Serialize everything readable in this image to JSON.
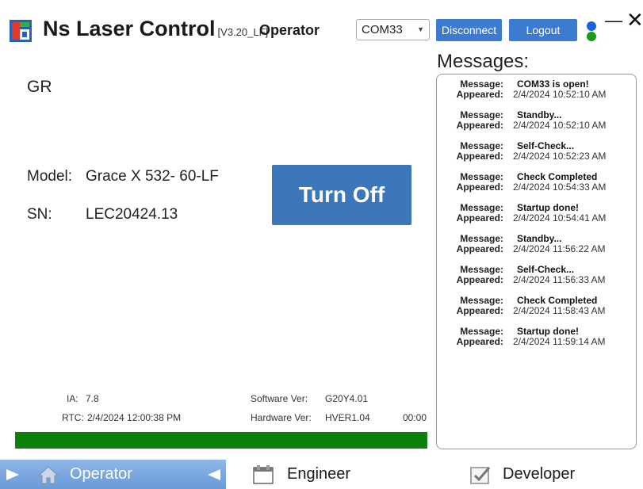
{
  "app": {
    "title": "Ns Laser Control",
    "version": "[V3.20_LF]",
    "mode": "Operator"
  },
  "toolbar": {
    "com_port": "COM33",
    "disconnect_label": "Disconnect",
    "logout_label": "Logout",
    "status_dot_colors": [
      "#1565e0",
      "#1a9a1a"
    ]
  },
  "main": {
    "gr_label": "GR",
    "model_label": "Model:",
    "model_value": "Grace X 532- 60-LF",
    "sn_label": "SN:",
    "sn_value": "LEC20424.13",
    "turn_off_label": "Turn Off",
    "ia_label": "IA:",
    "ia_value": "7.8",
    "rtc_label": "RTC:",
    "rtc_value": "2/4/2024 12:00:38 PM",
    "software_ver_label": "Software Ver:",
    "software_ver_value": "G20Y4.01",
    "hardware_ver_label": "Hardware Ver:",
    "hardware_ver_value": "HVER1.04",
    "timer": "00:00",
    "progress_fraction": 1.0
  },
  "messages": {
    "title": "Messages:",
    "message_key": "Message:",
    "appeared_key": "Appeared:",
    "items": [
      {
        "text": "COM33 is open!",
        "time": "2/4/2024 10:52:10 AM"
      },
      {
        "text": "Standby...",
        "time": "2/4/2024 10:52:10 AM"
      },
      {
        "text": "Self-Check...",
        "time": "2/4/2024 10:52:23 AM"
      },
      {
        "text": "Check Completed",
        "time": "2/4/2024 10:54:33 AM"
      },
      {
        "text": "Startup done!",
        "time": "2/4/2024 10:54:41 AM"
      },
      {
        "text": "Standby...",
        "time": "2/4/2024 11:56:22 AM"
      },
      {
        "text": "Self-Check...",
        "time": "2/4/2024 11:56:33 AM"
      },
      {
        "text": "Check Completed",
        "time": "2/4/2024 11:58:43 AM"
      },
      {
        "text": "Startup done!",
        "time": "2/4/2024 11:59:14 AM"
      }
    ]
  },
  "nav": {
    "operator_label": "Operator",
    "engineer_label": "Engineer",
    "developer_label": "Developer",
    "active_color": "#6a9ad8"
  }
}
